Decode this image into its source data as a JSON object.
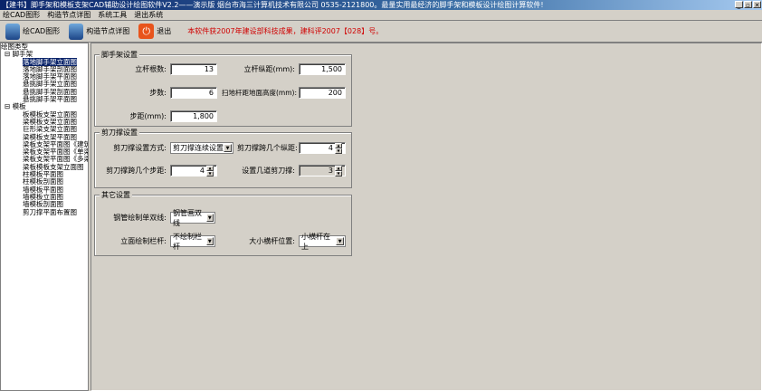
{
  "window": {
    "title": "【建书】脚手架和模板支架CAD辅助设计绘图软件V2.2——演示版  烟台市海三计算机技术有限公司 0535-2121800。最量实用最经济的脚手架和模板设计绘图计算软件!",
    "min": "_",
    "max": "▫",
    "close": "✕"
  },
  "menu": [
    "绘CAD图形",
    "构造节点详图",
    "系统工具",
    "退出系统"
  ],
  "toolbar": {
    "draw_cad": "绘CAD图形",
    "detail": "构造节点详图",
    "exit": "退出",
    "notice": "本软件获2007年建设部科技成果，建科评2007【028】号。"
  },
  "tree": {
    "root": "绘图类型",
    "groups": [
      {
        "label": "脚手架",
        "items": [
          "落地脚手架立面图",
          "落地脚手架剖面图",
          "落地脚手架平面图",
          "悬挑脚手架立面图",
          "悬挑脚手架剖面图",
          "悬挑脚手架平面图"
        ]
      },
      {
        "label": "模板",
        "items": [
          "板模板支架立面图",
          "梁模板支架立面图",
          "巨形梁支架立面图",
          "梁模板支架平面图",
          "梁板支架平面图《建筑",
          "梁板支架平面图《单梁",
          "梁板支架平面图《多梁",
          "梁板模板支架立面图",
          "柱模板平面图",
          "柱模板剖面图",
          "墙模板平面图",
          "墙模板立面图",
          "墙模板剖面图",
          "剪刀撑平面布置图"
        ]
      }
    ]
  },
  "scaffold": {
    "title": "脚手架设置",
    "poles_label": "立杆根数:",
    "poles": "13",
    "spacing_label": "立杆纵距(mm):",
    "spacing": "1,500",
    "steps_label": "步数:",
    "steps": "6",
    "sweep_label": "扫地杆距地面高度(mm):",
    "sweep": "200",
    "step_dist_label": "步距(mm):",
    "step_dist": "1,800"
  },
  "brace": {
    "title": "剪刀撑设置",
    "mode_label": "剪刀撑设置方式:",
    "mode": "剪刀撑连续设置",
    "span_label": "剪刀撑跨几个纵距:",
    "span": "4",
    "steps_label": "剪刀撑跨几个步距:",
    "steps": "4",
    "count_label": "设置几道剪刀撑:",
    "count": "3"
  },
  "other": {
    "title": "其它设置",
    "line_label": "钢管绘制单双线:",
    "line": "钢管画双线",
    "rail_label": "立面绘制栏杆:",
    "rail": "不绘制栏杆",
    "bar_label": "大小横杆位置:",
    "bar": "小横杆在上"
  }
}
